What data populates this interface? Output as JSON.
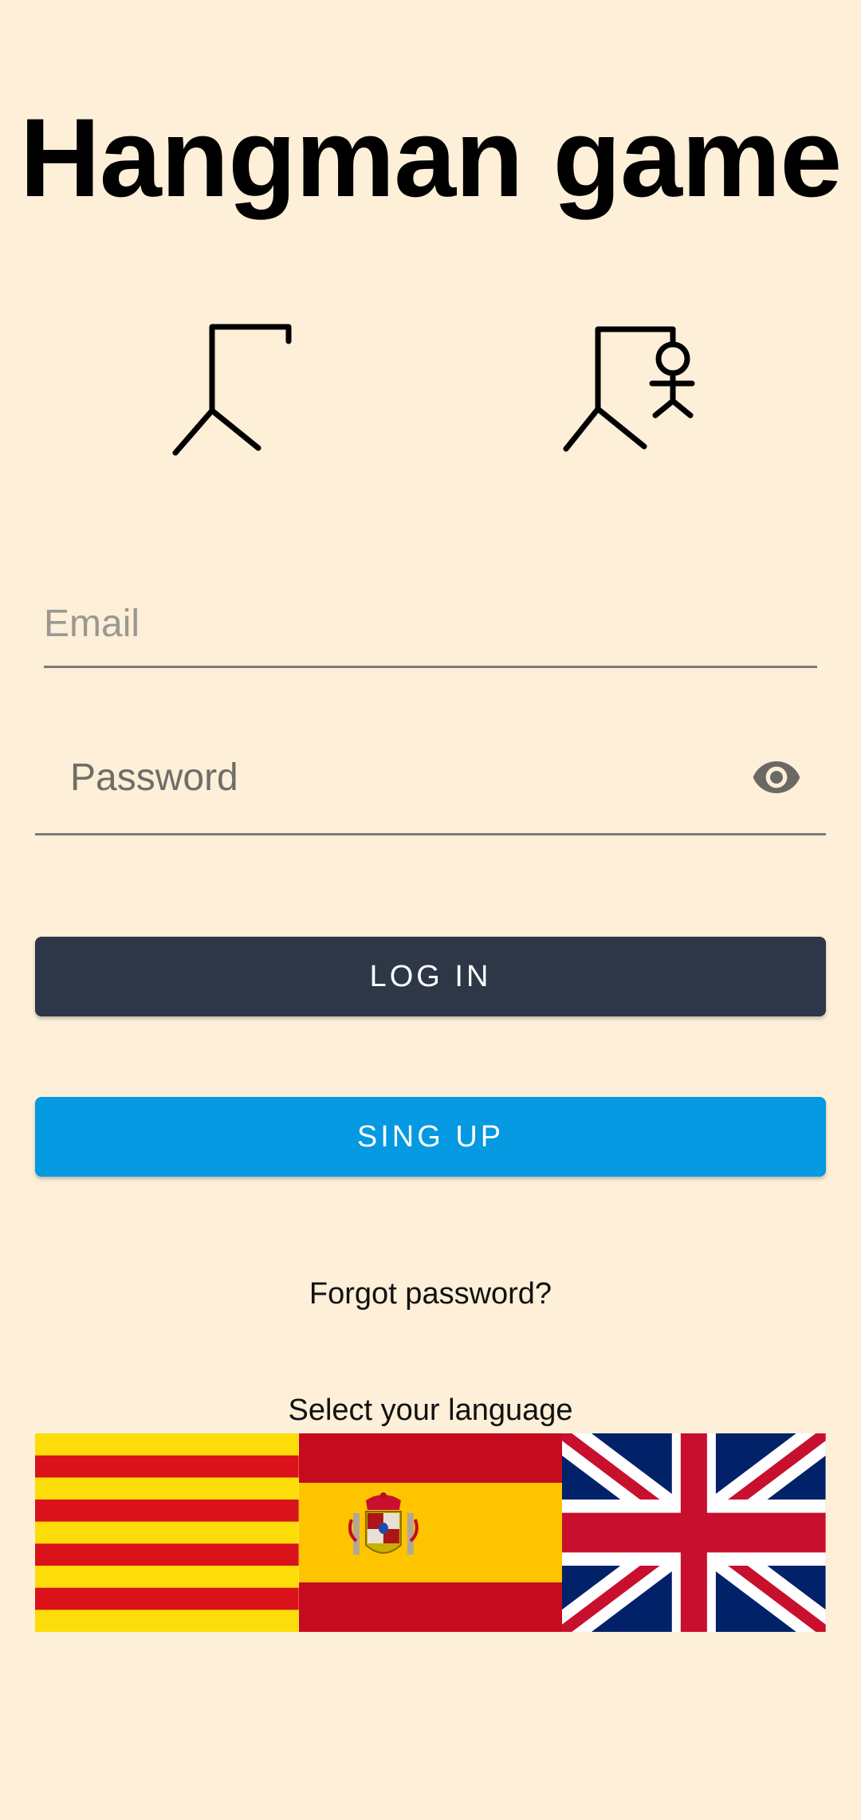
{
  "app": {
    "title": "Hangman game"
  },
  "form": {
    "email_placeholder": "Email",
    "password_placeholder": "Password"
  },
  "buttons": {
    "login_label": "LOG IN",
    "signup_label": "SING UP"
  },
  "links": {
    "forgot_password": "Forgot password?"
  },
  "language": {
    "label": "Select your language",
    "flags": [
      {
        "name": "Catalan",
        "icon": "catalan-flag-icon"
      },
      {
        "name": "Spanish",
        "icon": "spanish-flag-icon"
      },
      {
        "name": "English",
        "icon": "uk-flag-icon"
      }
    ]
  },
  "icons": {
    "gallows_empty": "gallows-icon",
    "gallows_full": "hangman-icon",
    "password_toggle": "eye-icon"
  },
  "colors": {
    "background": "#fdefd8",
    "login_button": "#2d3748",
    "signup_button": "#0499e1",
    "field_underline": "#7c7b77"
  }
}
